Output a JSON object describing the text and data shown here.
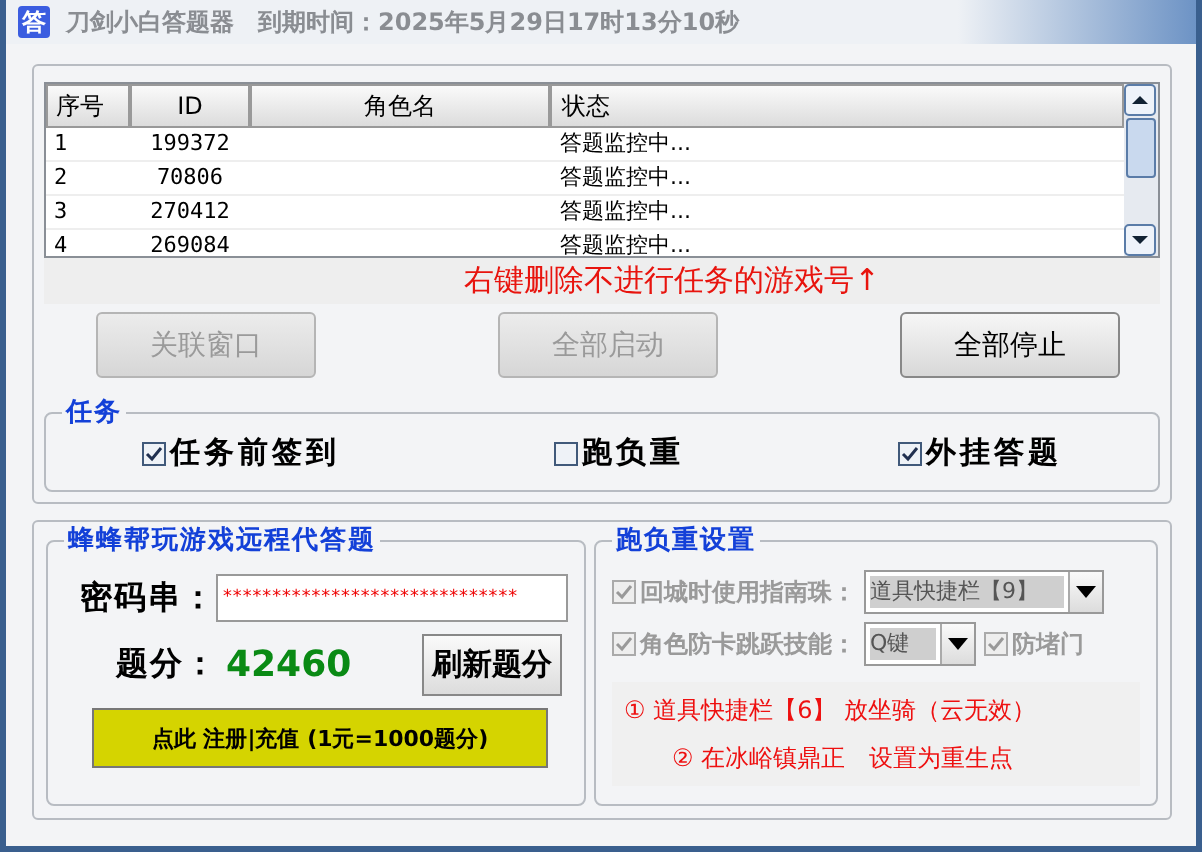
{
  "window": {
    "icon_char": "答",
    "title": "刀剑小白答题器",
    "expiry": "到期时间：2025年5月29日17时13分10秒"
  },
  "table": {
    "columns": [
      "序号",
      "ID",
      "角色名",
      "状态"
    ],
    "rows": [
      {
        "index": "1",
        "id": "199372",
        "status": "答题监控中..."
      },
      {
        "index": "2",
        "id": "70806",
        "status": "答题监控中..."
      },
      {
        "index": "3",
        "id": "270412",
        "status": "答题监控中..."
      },
      {
        "index": "4",
        "id": "269084",
        "status": "答题监控中..."
      }
    ]
  },
  "hint": "右键删除不进行任务的游戏号↑",
  "buttons": [
    {
      "label": "关联窗口",
      "disabled": true
    },
    {
      "label": "全部启动",
      "disabled": true
    },
    {
      "label": "全部停止",
      "disabled": false
    }
  ],
  "tasks": {
    "title": "任务",
    "options": [
      {
        "label": "任务前签到",
        "checked": true
      },
      {
        "label": "跑负重",
        "checked": false
      },
      {
        "label": "外挂答题",
        "checked": true
      }
    ]
  },
  "remote": {
    "title": "蜂蜂帮玩游戏远程代答题",
    "password_label": "密码串：",
    "password": "******************************",
    "score_label": "题分：",
    "score": "42460",
    "refresh_button": "刷新题分",
    "register_button": "点此 注册|充值 (1元=1000题分)"
  },
  "run": {
    "title": "跑负重设置",
    "settings": [
      {
        "label": "回城时使用指南珠：",
        "checked": true,
        "disabled": true,
        "dropdown": "道具快捷栏【9】"
      },
      {
        "label": "角色防卡跳跃技能：",
        "checked": true,
        "disabled": true,
        "dropdown": "Q键",
        "extra": {
          "label": "防堵门",
          "checked": true,
          "disabled": true
        }
      }
    ],
    "notes": [
      "① 道具快捷栏【6】 放坐骑（云无效）",
      "② 在冰峪镇鼎正　设置为重生点"
    ]
  }
}
